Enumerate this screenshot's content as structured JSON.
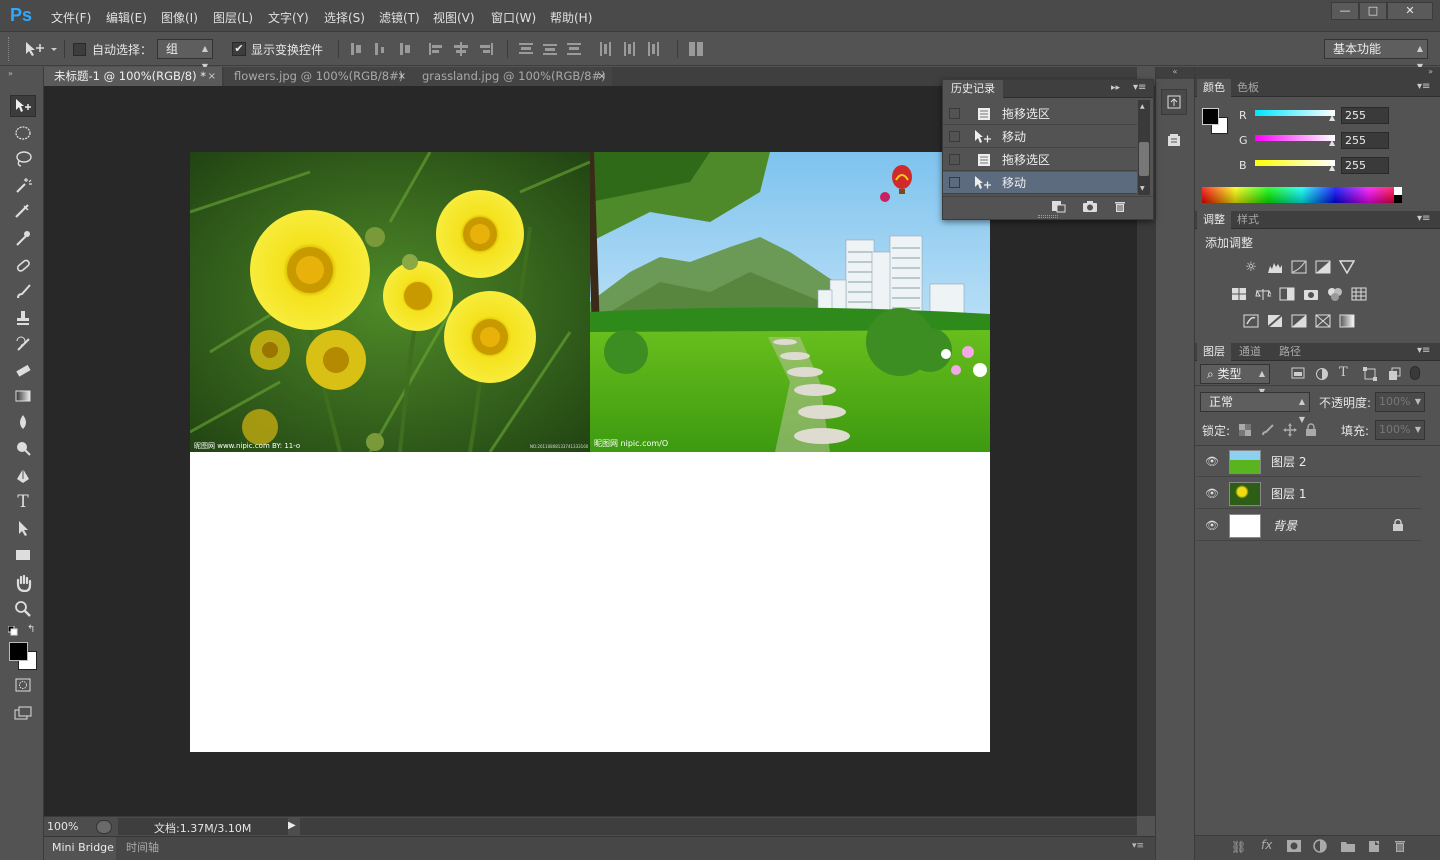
{
  "app": {
    "logo": "Ps"
  },
  "menu": [
    "文件(F)",
    "编辑(E)",
    "图像(I)",
    "图层(L)",
    "文字(Y)",
    "选择(S)",
    "滤镜(T)",
    "视图(V)",
    "窗口(W)",
    "帮助(H)"
  ],
  "window_buttons": {
    "minimize": "—",
    "maximize": "□",
    "close": "✕"
  },
  "options": {
    "auto_select_label": "自动选择：",
    "auto_select_value": "组",
    "show_transform_label": "显示变换控件",
    "workspace_value": "基本功能"
  },
  "tabs": [
    {
      "label": "未标题-1 @ 100%(RGB/8) *",
      "close": "×"
    },
    {
      "label": "flowers.jpg @ 100%(RGB/8#)",
      "close": "×"
    },
    {
      "label": "grassland.jpg @ 100%(RGB/8#)",
      "close": "×"
    }
  ],
  "canvas": {
    "flowers_watermark": "昵图网 www.nipic.com   BY: 11-o",
    "flowers_id": "NO:20110808133741333160",
    "grass_watermark": "昵图网 nipic.com/O"
  },
  "status": {
    "zoom": "100%",
    "doc": "文档:1.37M/3.10M"
  },
  "bottom_tabs": [
    "Mini Bridge",
    "时间轴"
  ],
  "history": {
    "title": "历史记录",
    "items": [
      {
        "label": "拖移选区",
        "icon": "document-icon"
      },
      {
        "label": "移动",
        "icon": "move-icon"
      },
      {
        "label": "拖移选区",
        "icon": "document-icon"
      },
      {
        "label": "移动",
        "icon": "move-icon",
        "current": true
      }
    ]
  },
  "color_panel": {
    "tabs": [
      "颜色",
      "色板"
    ],
    "channels": [
      {
        "label": "R",
        "value": "255",
        "color": "#00e5ff"
      },
      {
        "label": "G",
        "value": "255",
        "color": "#ff00ff"
      },
      {
        "label": "B",
        "value": "255",
        "color": "#ffff00"
      }
    ]
  },
  "adjust_panel": {
    "tabs": [
      "调整",
      "样式"
    ],
    "heading": "添加调整"
  },
  "layers_panel": {
    "tabs": [
      "图层",
      "通道",
      "路径"
    ],
    "filter_value": "类型",
    "blend_mode": "正常",
    "opacity_label": "不透明度:",
    "opacity_value": "100%",
    "lock_label": "锁定:",
    "fill_label": "填充:",
    "fill_value": "100%",
    "layers": [
      {
        "name": "图层 2",
        "thumb": "grass"
      },
      {
        "name": "图层 1",
        "thumb": "flowers"
      },
      {
        "name": "背景",
        "thumb": "white",
        "locked": true
      }
    ]
  }
}
